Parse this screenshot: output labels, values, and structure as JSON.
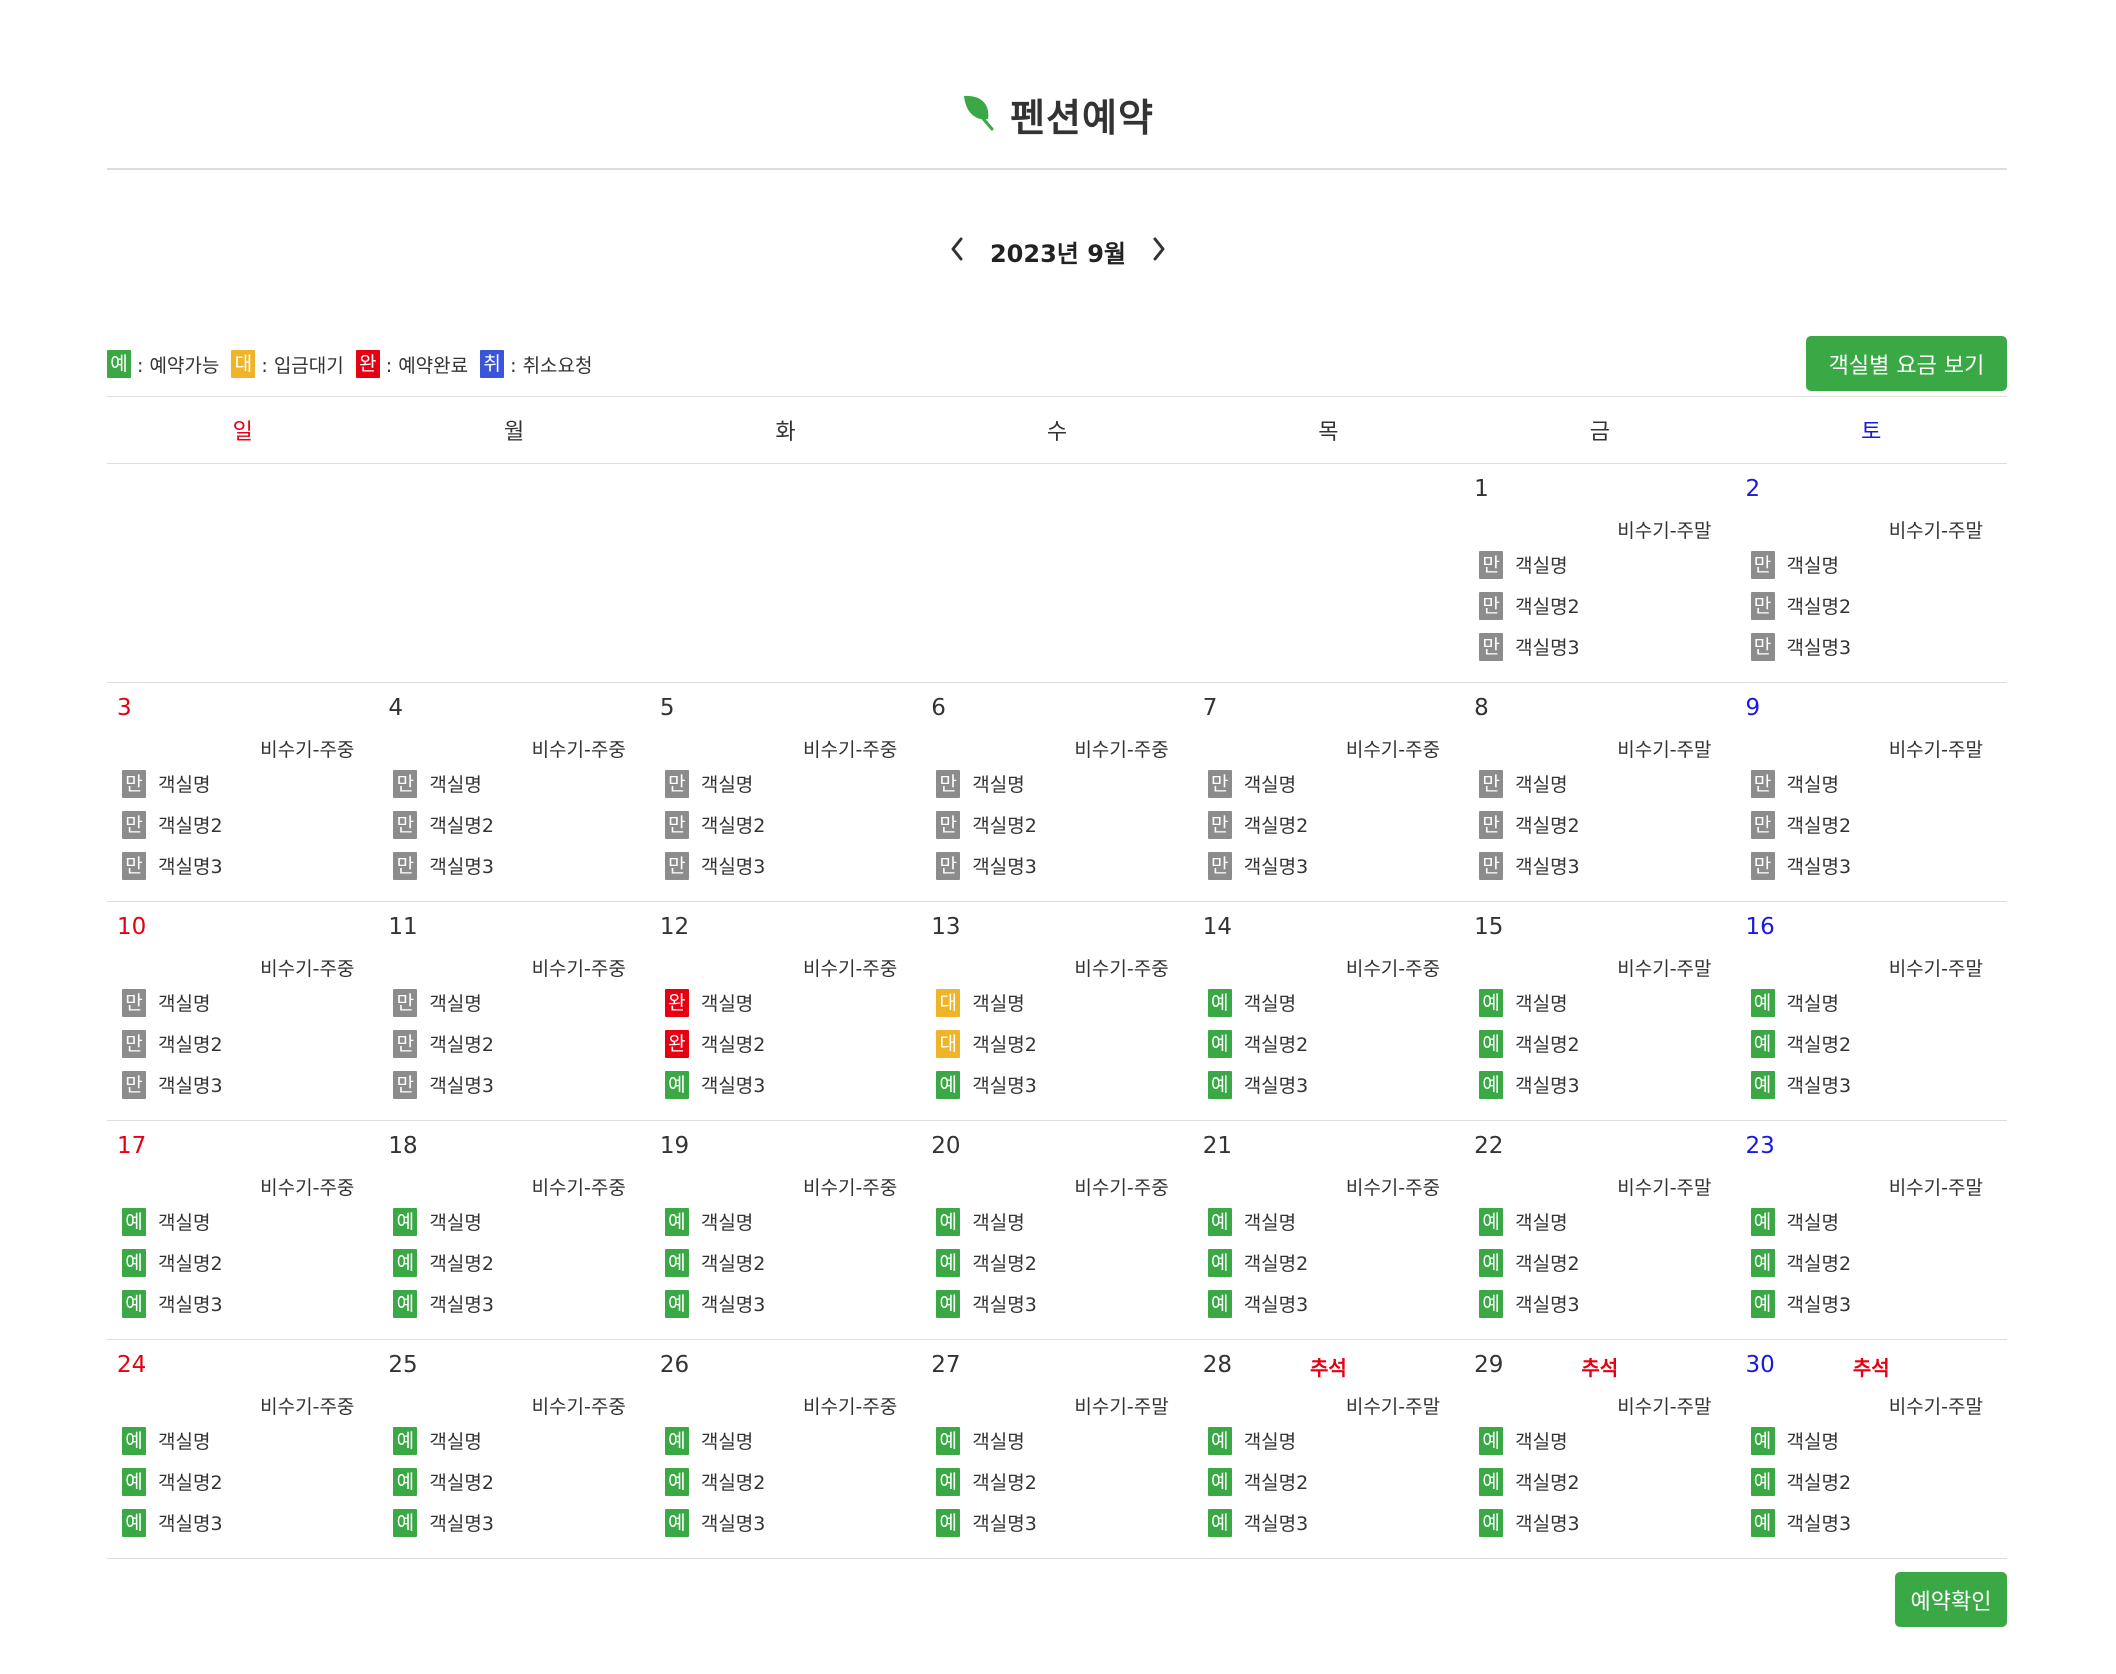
{
  "header": {
    "title": "펜션예약",
    "logo_icon": "leaf-icon",
    "accent_color": "#3aa845"
  },
  "calendar_nav": {
    "month_label": "2023년 9월",
    "prev_icon": "chevron-left-icon",
    "next_icon": "chevron-right-icon"
  },
  "legend": [
    {
      "code": "예",
      "label": ": 예약가능",
      "color": "#3aa845"
    },
    {
      "code": "대",
      "label": ": 입금대기",
      "color": "#f0b429"
    },
    {
      "code": "완",
      "label": ": 예약완료",
      "color": "#e60012"
    },
    {
      "code": "취",
      "label": ": 취소요청",
      "color": "#3b55d9"
    }
  ],
  "status_colors": {
    "만": "#8c8c8c",
    "예": "#3aa845",
    "대": "#f0b429",
    "완": "#e60012",
    "취": "#3b55d9"
  },
  "buttons": {
    "rate": "객실별 요금 보기",
    "confirm": "예약확인"
  },
  "weekdays": [
    "일",
    "월",
    "화",
    "수",
    "목",
    "금",
    "토"
  ],
  "weeks": [
    [
      null,
      null,
      null,
      null,
      null,
      {
        "day": "1",
        "season": "비수기-주말",
        "rooms": [
          {
            "status": "만",
            "name": "객실명"
          },
          {
            "status": "만",
            "name": "객실명2"
          },
          {
            "status": "만",
            "name": "객실명3"
          }
        ]
      },
      {
        "day": "2",
        "season": "비수기-주말",
        "rooms": [
          {
            "status": "만",
            "name": "객실명"
          },
          {
            "status": "만",
            "name": "객실명2"
          },
          {
            "status": "만",
            "name": "객실명3"
          }
        ]
      }
    ],
    [
      {
        "day": "3",
        "season": "비수기-주중",
        "rooms": [
          {
            "status": "만",
            "name": "객실명"
          },
          {
            "status": "만",
            "name": "객실명2"
          },
          {
            "status": "만",
            "name": "객실명3"
          }
        ]
      },
      {
        "day": "4",
        "season": "비수기-주중",
        "rooms": [
          {
            "status": "만",
            "name": "객실명"
          },
          {
            "status": "만",
            "name": "객실명2"
          },
          {
            "status": "만",
            "name": "객실명3"
          }
        ]
      },
      {
        "day": "5",
        "season": "비수기-주중",
        "rooms": [
          {
            "status": "만",
            "name": "객실명"
          },
          {
            "status": "만",
            "name": "객실명2"
          },
          {
            "status": "만",
            "name": "객실명3"
          }
        ]
      },
      {
        "day": "6",
        "season": "비수기-주중",
        "rooms": [
          {
            "status": "만",
            "name": "객실명"
          },
          {
            "status": "만",
            "name": "객실명2"
          },
          {
            "status": "만",
            "name": "객실명3"
          }
        ]
      },
      {
        "day": "7",
        "season": "비수기-주중",
        "rooms": [
          {
            "status": "만",
            "name": "객실명"
          },
          {
            "status": "만",
            "name": "객실명2"
          },
          {
            "status": "만",
            "name": "객실명3"
          }
        ]
      },
      {
        "day": "8",
        "season": "비수기-주말",
        "rooms": [
          {
            "status": "만",
            "name": "객실명"
          },
          {
            "status": "만",
            "name": "객실명2"
          },
          {
            "status": "만",
            "name": "객실명3"
          }
        ]
      },
      {
        "day": "9",
        "season": "비수기-주말",
        "rooms": [
          {
            "status": "만",
            "name": "객실명"
          },
          {
            "status": "만",
            "name": "객실명2"
          },
          {
            "status": "만",
            "name": "객실명3"
          }
        ]
      }
    ],
    [
      {
        "day": "10",
        "season": "비수기-주중",
        "rooms": [
          {
            "status": "만",
            "name": "객실명"
          },
          {
            "status": "만",
            "name": "객실명2"
          },
          {
            "status": "만",
            "name": "객실명3"
          }
        ]
      },
      {
        "day": "11",
        "season": "비수기-주중",
        "rooms": [
          {
            "status": "만",
            "name": "객실명"
          },
          {
            "status": "만",
            "name": "객실명2"
          },
          {
            "status": "만",
            "name": "객실명3"
          }
        ]
      },
      {
        "day": "12",
        "season": "비수기-주중",
        "rooms": [
          {
            "status": "완",
            "name": "객실명"
          },
          {
            "status": "완",
            "name": "객실명2"
          },
          {
            "status": "예",
            "name": "객실명3"
          }
        ]
      },
      {
        "day": "13",
        "season": "비수기-주중",
        "rooms": [
          {
            "status": "대",
            "name": "객실명"
          },
          {
            "status": "대",
            "name": "객실명2"
          },
          {
            "status": "예",
            "name": "객실명3"
          }
        ]
      },
      {
        "day": "14",
        "season": "비수기-주중",
        "rooms": [
          {
            "status": "예",
            "name": "객실명"
          },
          {
            "status": "예",
            "name": "객실명2"
          },
          {
            "status": "예",
            "name": "객실명3"
          }
        ]
      },
      {
        "day": "15",
        "season": "비수기-주말",
        "rooms": [
          {
            "status": "예",
            "name": "객실명"
          },
          {
            "status": "예",
            "name": "객실명2"
          },
          {
            "status": "예",
            "name": "객실명3"
          }
        ]
      },
      {
        "day": "16",
        "season": "비수기-주말",
        "rooms": [
          {
            "status": "예",
            "name": "객실명"
          },
          {
            "status": "예",
            "name": "객실명2"
          },
          {
            "status": "예",
            "name": "객실명3"
          }
        ]
      }
    ],
    [
      {
        "day": "17",
        "season": "비수기-주중",
        "rooms": [
          {
            "status": "예",
            "name": "객실명"
          },
          {
            "status": "예",
            "name": "객실명2"
          },
          {
            "status": "예",
            "name": "객실명3"
          }
        ]
      },
      {
        "day": "18",
        "season": "비수기-주중",
        "rooms": [
          {
            "status": "예",
            "name": "객실명"
          },
          {
            "status": "예",
            "name": "객실명2"
          },
          {
            "status": "예",
            "name": "객실명3"
          }
        ]
      },
      {
        "day": "19",
        "season": "비수기-주중",
        "rooms": [
          {
            "status": "예",
            "name": "객실명"
          },
          {
            "status": "예",
            "name": "객실명2"
          },
          {
            "status": "예",
            "name": "객실명3"
          }
        ]
      },
      {
        "day": "20",
        "season": "비수기-주중",
        "rooms": [
          {
            "status": "예",
            "name": "객실명"
          },
          {
            "status": "예",
            "name": "객실명2"
          },
          {
            "status": "예",
            "name": "객실명3"
          }
        ]
      },
      {
        "day": "21",
        "season": "비수기-주중",
        "rooms": [
          {
            "status": "예",
            "name": "객실명"
          },
          {
            "status": "예",
            "name": "객실명2"
          },
          {
            "status": "예",
            "name": "객실명3"
          }
        ]
      },
      {
        "day": "22",
        "season": "비수기-주말",
        "rooms": [
          {
            "status": "예",
            "name": "객실명"
          },
          {
            "status": "예",
            "name": "객실명2"
          },
          {
            "status": "예",
            "name": "객실명3"
          }
        ]
      },
      {
        "day": "23",
        "season": "비수기-주말",
        "rooms": [
          {
            "status": "예",
            "name": "객실명"
          },
          {
            "status": "예",
            "name": "객실명2"
          },
          {
            "status": "예",
            "name": "객실명3"
          }
        ]
      }
    ],
    [
      {
        "day": "24",
        "season": "비수기-주중",
        "rooms": [
          {
            "status": "예",
            "name": "객실명"
          },
          {
            "status": "예",
            "name": "객실명2"
          },
          {
            "status": "예",
            "name": "객실명3"
          }
        ]
      },
      {
        "day": "25",
        "season": "비수기-주중",
        "rooms": [
          {
            "status": "예",
            "name": "객실명"
          },
          {
            "status": "예",
            "name": "객실명2"
          },
          {
            "status": "예",
            "name": "객실명3"
          }
        ]
      },
      {
        "day": "26",
        "season": "비수기-주중",
        "rooms": [
          {
            "status": "예",
            "name": "객실명"
          },
          {
            "status": "예",
            "name": "객실명2"
          },
          {
            "status": "예",
            "name": "객실명3"
          }
        ]
      },
      {
        "day": "27",
        "season": "비수기-주말",
        "rooms": [
          {
            "status": "예",
            "name": "객실명"
          },
          {
            "status": "예",
            "name": "객실명2"
          },
          {
            "status": "예",
            "name": "객실명3"
          }
        ]
      },
      {
        "day": "28",
        "holiday": "추석",
        "season": "비수기-주말",
        "rooms": [
          {
            "status": "예",
            "name": "객실명"
          },
          {
            "status": "예",
            "name": "객실명2"
          },
          {
            "status": "예",
            "name": "객실명3"
          }
        ]
      },
      {
        "day": "29",
        "holiday": "추석",
        "season": "비수기-주말",
        "rooms": [
          {
            "status": "예",
            "name": "객실명"
          },
          {
            "status": "예",
            "name": "객실명2"
          },
          {
            "status": "예",
            "name": "객실명3"
          }
        ]
      },
      {
        "day": "30",
        "holiday": "추석",
        "season": "비수기-주말",
        "rooms": [
          {
            "status": "예",
            "name": "객실명"
          },
          {
            "status": "예",
            "name": "객실명2"
          },
          {
            "status": "예",
            "name": "객실명3"
          }
        ]
      }
    ]
  ]
}
